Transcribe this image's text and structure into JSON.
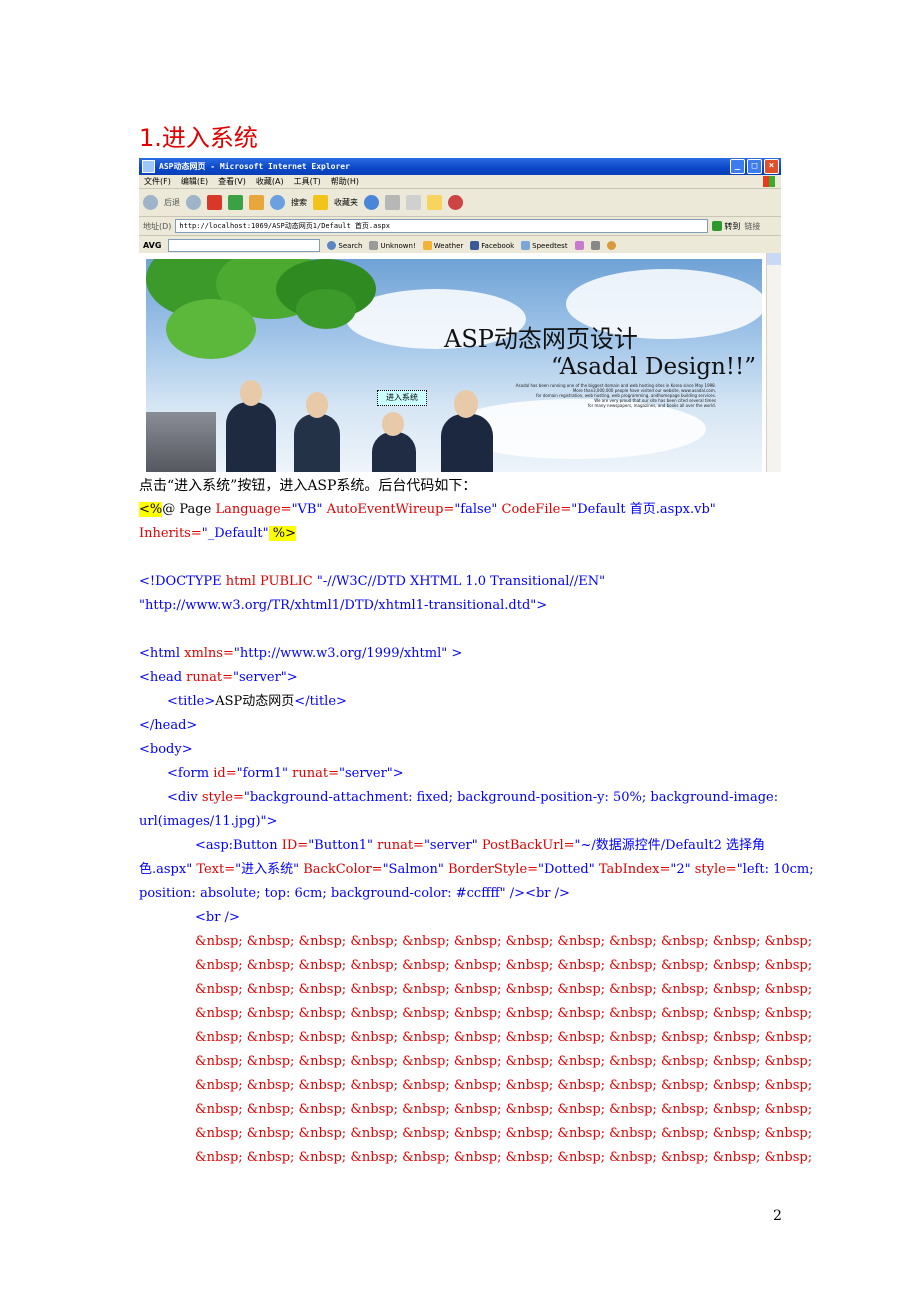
{
  "heading": "1.进入系统",
  "window": {
    "title": "ASP动态网页 - Microsoft Internet Explorer",
    "menu": [
      "文件(F)",
      "编辑(E)",
      "查看(V)",
      "收藏(A)",
      "工具(T)",
      "帮助(H)"
    ],
    "back_label": "后退",
    "search_label": "搜索",
    "favorites_label": "收藏夹",
    "address_label": "地址(D)",
    "address_value": "http://localhost:1069/ASP动态网页1/Default 首页.aspx",
    "go_label": "转到",
    "links_label": "链接",
    "avg": {
      "logo": "AVG",
      "search_label": "Search",
      "unknown_label": "Unknown!",
      "weather_label": "Weather",
      "facebook_label": "Facebook",
      "speedtest_label": "Speedtest"
    },
    "banner": {
      "title": "ASP动态网页设计",
      "subtitle": "“Asadal Design!!”",
      "blurb_lines": [
        "Asadal has been running one of the biggest domain and web hosting sites in Korea since May 1998.",
        "More than3,000,000 people have visited our website, www.asadal.com,",
        "for domain registration, web hosting, web programming, andhomepage building services.",
        "We are very proud that our site has been cited several times",
        "for many newspapers, magazines, and books all over the world."
      ],
      "enter_button": "进入系统"
    }
  },
  "intro_text": "点击“进入系统”按钮，进入ASP系统。后台代码如下：",
  "code": {
    "l1_open": "<%",
    "l1_rest": "@ Page ",
    "l1_lang_attr": "Language=",
    "l1_lang_val": "\"VB\"",
    "l1_auto_attr": " AutoEventWireup=",
    "l1_auto_val": "\"false\"",
    "l1_cf_attr": " CodeFile=",
    "l1_cf_val": "\"Default  首页.aspx.vb\"",
    "l2_inh_attr": "Inherits=",
    "l2_inh_val": "\"_Default\"",
    "l2_close": " %>",
    "doctype_a": "<!DOCTYPE ",
    "doctype_b": "html PUBLIC ",
    "doctype_c": "\"-//W3C//DTD XHTML 1.0 Transitional//EN\"",
    "doctype_d": "\"http://www.w3.org/TR/xhtml1/DTD/xhtml1-transitional.dtd\">",
    "html_a": "<html ",
    "html_b": "xmlns=",
    "html_c": "\"http://www.w3.org/1999/xhtml\" >",
    "head_a": "<head ",
    "head_b": "runat=",
    "head_c": "\"server\">",
    "title_a": "<title>",
    "title_b": "ASP动态网页",
    "title_c": "</title>",
    "head_close": "</head>",
    "body_open": "<body>",
    "form_a": "<form ",
    "form_b": "id=",
    "form_c": "\"form1\" ",
    "form_d": "runat=",
    "form_e": "\"server\">",
    "div_a": "<div ",
    "div_b": "style=",
    "div_c": "\"background-attachment: fixed; background-position-y: 50%; background-image:",
    "div_d": "url(images/11.jpg)\">",
    "asp_a": "<asp:Button ",
    "asp_b": "ID=",
    "asp_c": "\"Button1\" ",
    "asp_d": "runat=",
    "asp_e": "\"server\" ",
    "asp_f": "PostBackUrl=",
    "asp_g": "\"~/数据源控件/Default2    选择角",
    "asp_h": "色.aspx\" ",
    "asp_i": "Text=",
    "asp_j": "\"进入系统\" ",
    "asp_k": "BackColor=",
    "asp_l": "\"Salmon\" ",
    "asp_m": "BorderStyle=",
    "asp_n": "\"Dotted\" ",
    "asp_o": "TabIndex=",
    "asp_p": "\"2\" ",
    "asp_q": "style=",
    "asp_r": "\"left: 10cm;",
    "asp_s": "position: absolute; top: 6cm; background-color: #ccffff\" />",
    "asp_t": "<br />",
    "br": "<br />",
    "nbsp_line": "&nbsp; &nbsp; &nbsp; &nbsp; &nbsp; &nbsp; &nbsp; &nbsp; &nbsp; &nbsp; &nbsp; &nbsp;"
  },
  "page_number": "2"
}
